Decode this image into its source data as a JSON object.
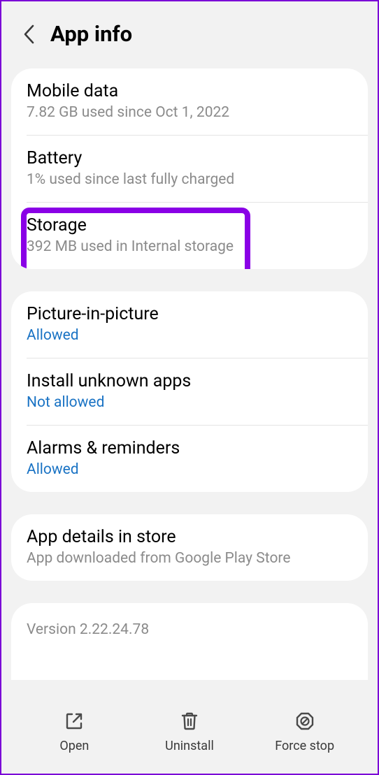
{
  "header": {
    "title": "App info"
  },
  "groups": {
    "usage": {
      "mobile_data": {
        "title": "Mobile data",
        "sub": "7.82 GB used since Oct 1, 2022"
      },
      "battery": {
        "title": "Battery",
        "sub": "1% used since last fully charged"
      },
      "storage": {
        "title": "Storage",
        "sub": "392 MB used in Internal storage"
      }
    },
    "permissions": {
      "pip": {
        "title": "Picture-in-picture",
        "status": "Allowed"
      },
      "unknown": {
        "title": "Install unknown apps",
        "status": "Not allowed"
      },
      "alarms": {
        "title": "Alarms & reminders",
        "status": "Allowed"
      }
    },
    "store": {
      "title": "App details in store",
      "sub": "App downloaded from Google Play Store"
    },
    "version": {
      "text": "Version 2.22.24.78"
    }
  },
  "bottom": {
    "open": "Open",
    "uninstall": "Uninstall",
    "force_stop": "Force stop"
  }
}
